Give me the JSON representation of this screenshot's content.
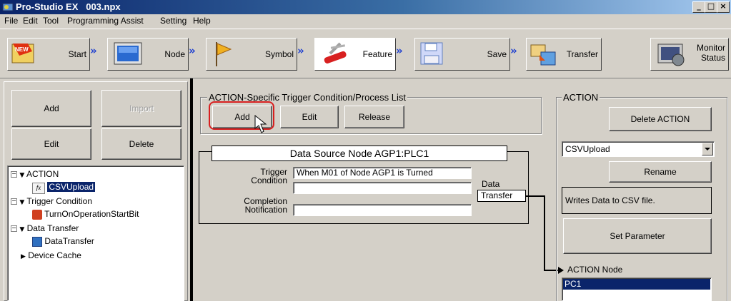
{
  "window": {
    "title": "Pro-Studio EX   003.npx",
    "controls": [
      "_",
      "□",
      "×"
    ]
  },
  "menu": [
    "File",
    "Edit",
    "Tool",
    "Programming Assist",
    "Setting",
    "Help"
  ],
  "toolbar": {
    "steps": [
      {
        "label": "Start",
        "icon": "new-icon"
      },
      {
        "label": "Node",
        "icon": "monitor-icon"
      },
      {
        "label": "Symbol",
        "icon": "flag-icon"
      },
      {
        "label": "Feature",
        "icon": "swiss-knife-icon"
      },
      {
        "label": "Save",
        "icon": "floppy-icon"
      },
      {
        "label": "Transfer",
        "icon": "transfer-icon"
      }
    ],
    "arrow": "»",
    "monitor_status": {
      "line1": "Monitor",
      "line2": "Status"
    }
  },
  "left_panel": {
    "add": "Add",
    "import": "Import",
    "edit": "Edit",
    "delete": "Delete",
    "tree": [
      {
        "label": "ACTION",
        "level": 0
      },
      {
        "label": "CSVUpload",
        "level": 1,
        "selected": true
      },
      {
        "label": "Trigger Condition",
        "level": 0
      },
      {
        "label": "TurnOnOperationStartBit",
        "level": 1
      },
      {
        "label": "Data Transfer",
        "level": 0
      },
      {
        "label": "DataTransfer",
        "level": 1
      },
      {
        "label": "Device Cache",
        "level": 0
      }
    ]
  },
  "trigger_list": {
    "title": "ACTION-Specific Trigger Condition/Process List",
    "add": "Add",
    "edit": "Edit",
    "release": "Release"
  },
  "data_source": {
    "title": "Data Source Node AGP1:PLC1",
    "trigger_label_1": "Trigger",
    "trigger_label_2": "Condition",
    "trigger_value": "When M01 of Node AGP1 is Turned",
    "completion_label_1": "Completion",
    "completion_label_2": "Notification",
    "completion_value": "",
    "data_label": "Data",
    "transfer_label": "Transfer"
  },
  "action_panel": {
    "title": "ACTION",
    "delete_action": "Delete ACTION",
    "selected_action": "CSVUpload",
    "rename": "Rename",
    "description": "Writes Data to CSV file.",
    "set_parameter": "Set Parameter",
    "node_label": "ACTION Node",
    "nodes": [
      "PC1"
    ]
  },
  "colors": {
    "highlight": "#d82020",
    "selection": "#0a246a"
  }
}
